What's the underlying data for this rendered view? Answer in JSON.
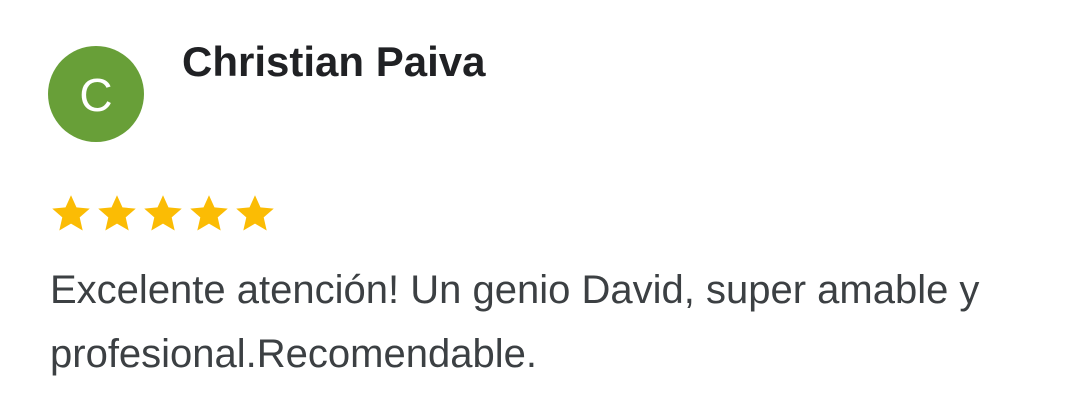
{
  "review": {
    "avatar_letter": "C",
    "avatar_color": "#689f38",
    "author_name": "Christian Paiva",
    "rating": 5,
    "rating_max": 5,
    "star_color": "#fbbc04",
    "star_icon": "star-icon",
    "text": "Excelente atención! Un genio David, super amable y profesional.Recomendable."
  }
}
